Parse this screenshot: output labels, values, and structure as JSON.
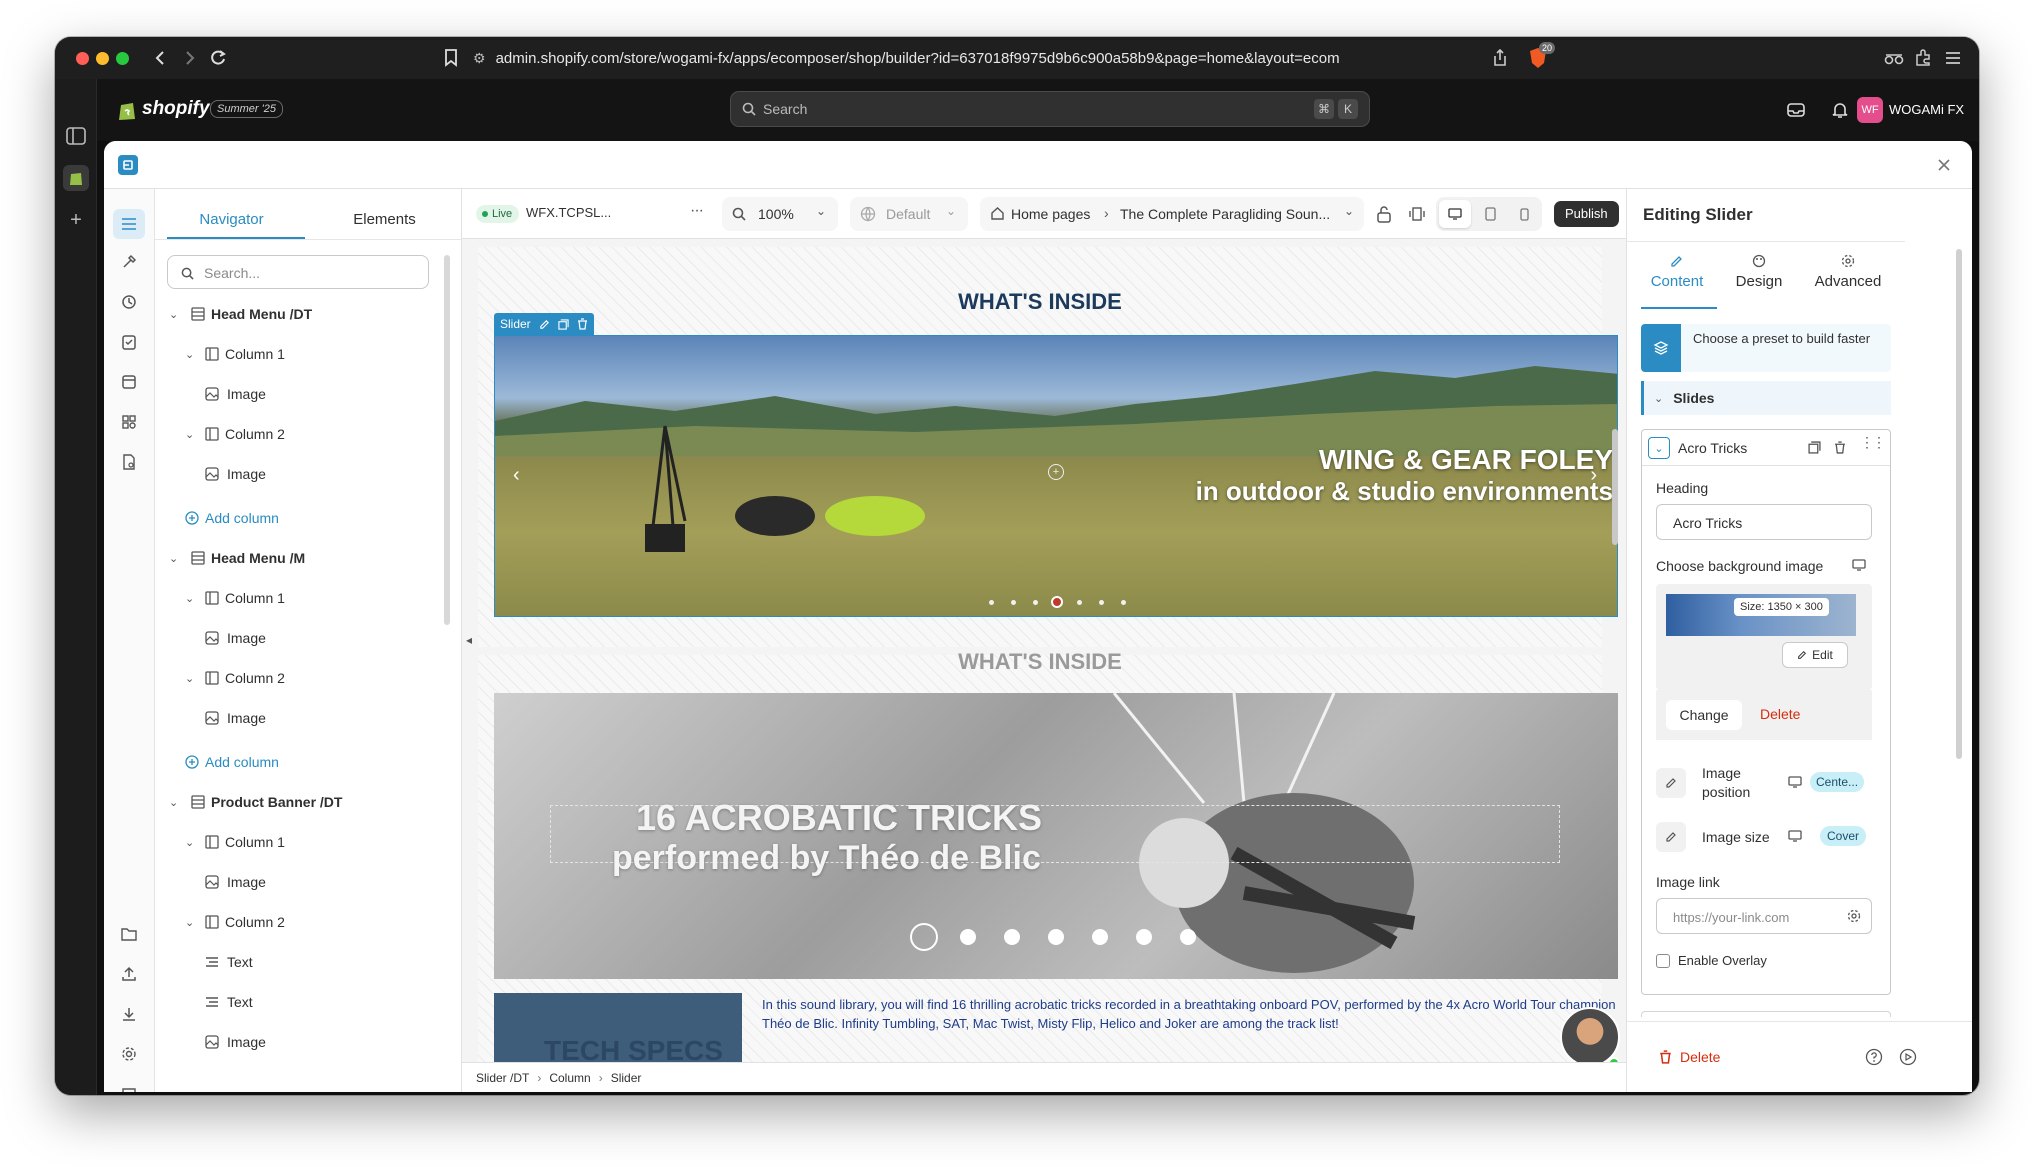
{
  "browser": {
    "url": "admin.shopify.com/store/wogami-fx/apps/ecomposer/shop/builder?id=637018f9975d9b6c900a58b9&page=home&layout=ecom",
    "extension_badge": "20"
  },
  "shopify": {
    "brand": "shopify",
    "edition": "Summer '25",
    "search_placeholder": "Search",
    "shortcut_key1": "⌘",
    "shortcut_key2": "K",
    "avatar_initials": "WF",
    "store_name": "WOGAMi FX"
  },
  "navigator": {
    "tabs": [
      "Navigator",
      "Elements"
    ],
    "search_placeholder": "Search...",
    "items": [
      {
        "label": "Head Menu /DT"
      },
      {
        "label": "Column 1"
      },
      {
        "label": "Image"
      },
      {
        "label": "Column 2"
      },
      {
        "label": "Image"
      },
      {
        "label": "Add column"
      },
      {
        "label": "Head Menu /M"
      },
      {
        "label": "Column 1"
      },
      {
        "label": "Image"
      },
      {
        "label": "Column 2"
      },
      {
        "label": "Image"
      },
      {
        "label": "Add column"
      },
      {
        "label": "Product Banner /DT"
      },
      {
        "label": "Column 1"
      },
      {
        "label": "Image"
      },
      {
        "label": "Column 2"
      },
      {
        "label": "Text"
      },
      {
        "label": "Text"
      },
      {
        "label": "Image"
      }
    ]
  },
  "toolbar": {
    "live_label": "Live",
    "file_name": "WFX.TCPSL...",
    "more": "···",
    "zoom": "100%",
    "theme": "Default",
    "breadcrumb_root": "Home pages",
    "page_title": "The Complete Paragliding Soun...",
    "publish": "Publish"
  },
  "canvas": {
    "section1_heading": "WHAT'S INSIDE",
    "slider_badge": "Slider",
    "slide1_line1": "WING & GEAR FOLEY",
    "slide1_line2": "in outdoor & studio environments",
    "section2_heading": "WHAT'S INSIDE",
    "slide2_line1": "16 ACROBATIC TRICKS",
    "slide2_line2": "performed by Théo de Blic",
    "tech_specs": "TECH SPECS",
    "description": "In this sound library, you will find 16 thrilling acrobatic tricks recorded in a breathtaking onboard POV, performed by the 4x Acro World Tour champion Théo de Blic. Infinity Tumbling, SAT, Mac Twist, Misty Flip, Helico and Joker are among the track list!",
    "slider1_dot_count": 7,
    "slider1_active_dot": 4,
    "slider2_dot_count": 7,
    "slider2_active_dot": 1
  },
  "footer_breadcrumb": [
    "Slider /DT",
    "Column",
    "Slider"
  ],
  "inspector": {
    "title": "Editing Slider",
    "tabs": [
      "Content",
      "Design",
      "Advanced"
    ],
    "preset_text": "Choose a preset to build faster",
    "slides_label": "Slides",
    "slide_name": "Acro Tricks",
    "heading_label": "Heading",
    "heading_value": "Acro Tricks",
    "bg_label": "Choose background image",
    "thumb_size": "Size: 1350 × 300",
    "edit_btn": "Edit",
    "change_btn": "Change",
    "delete_btn": "Delete",
    "image_position_label": "Image position",
    "image_position_value": "Cente...",
    "image_size_label": "Image size",
    "image_size_value": "Cover",
    "image_link_label": "Image link",
    "image_link_placeholder": "https://your-link.com",
    "enable_overlay": "Enable Overlay",
    "footer_delete": "Delete"
  },
  "colors": {
    "accent": "#2a8cc2",
    "brand_green": "#95bf47",
    "danger": "#d72c0d",
    "dark_bg": "#141414",
    "heading_navy": "#1b3a5c"
  }
}
